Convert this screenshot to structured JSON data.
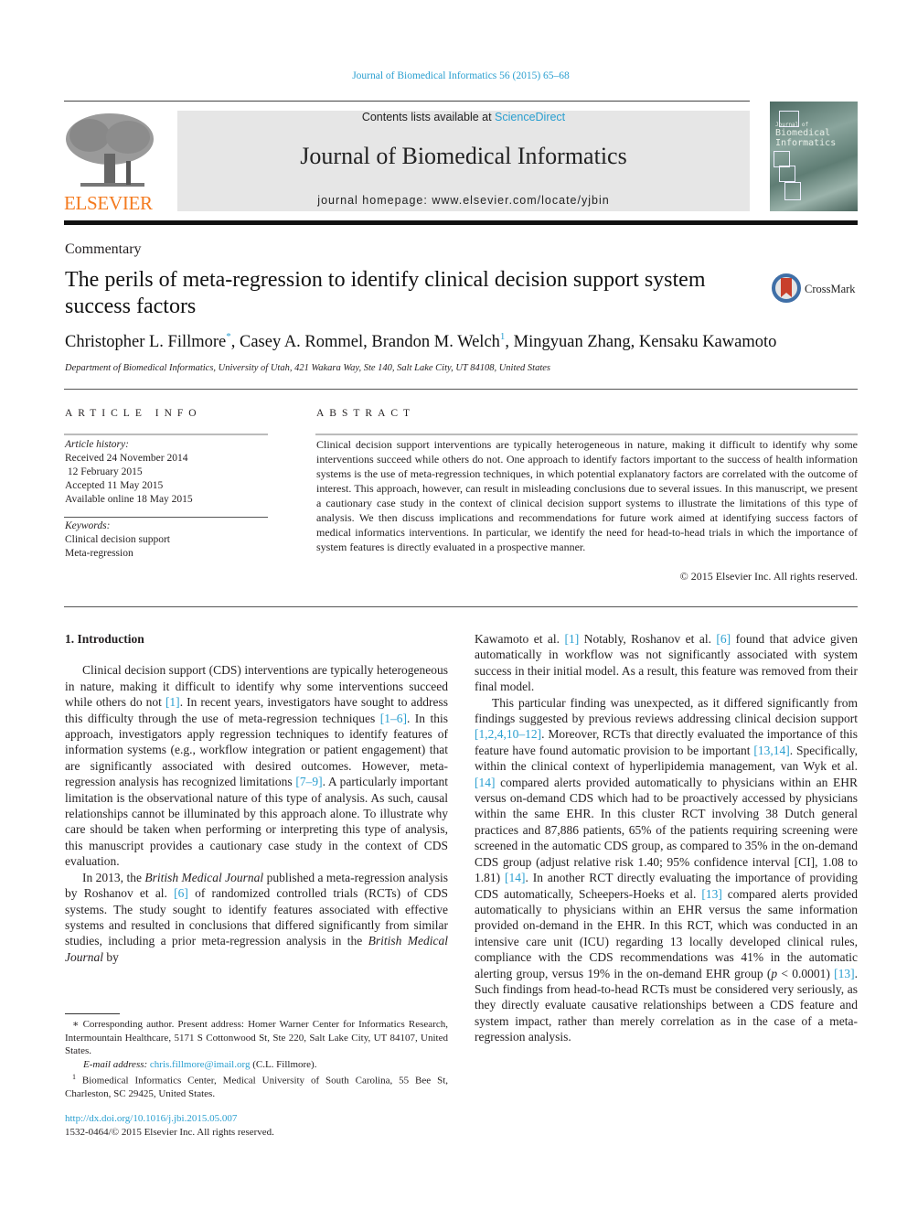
{
  "header": {
    "journal_reference": "Journal of Biomedical Informatics 56 (2015) 65–68",
    "contents_prefix": "Contents lists available at ",
    "contents_link": "ScienceDirect",
    "journal_title": "Journal of Biomedical Informatics",
    "homepage_prefix": "journal homepage: ",
    "homepage_url": "www.elsevier.com/locate/yjbin",
    "publisher_logo_text": "ELSEVIER",
    "cover_text_line1": "Biomedical",
    "cover_text_line2": "Informatics",
    "cover_small": "Journal of"
  },
  "article": {
    "type": "Commentary",
    "title": "The perils of meta-regression to identify clinical decision support system success factors",
    "crossmark_label": "CrossMark",
    "authors": [
      {
        "name": "Christopher L. Fillmore",
        "mark": "*"
      },
      {
        "name": "Casey A. Rommel",
        "mark": ""
      },
      {
        "name": "Brandon M. Welch",
        "mark": "1"
      },
      {
        "name": "Mingyuan Zhang",
        "mark": ""
      },
      {
        "name": "Kensaku Kawamoto",
        "mark": ""
      }
    ],
    "affiliation": "Department of Biomedical Informatics, University of Utah, 421 Wakara Way, Ste 140, Salt Lake City, UT 84108, United States"
  },
  "article_info": {
    "heading": "ARTICLE INFO",
    "history_label": "Article history:",
    "history": [
      "Received 24 November 2014",
      " 12 February 2015",
      "Accepted 11 May 2015",
      "Available online 18 May 2015"
    ],
    "keywords_label": "Keywords:",
    "keywords": [
      "Clinical decision support",
      "Meta-regression"
    ]
  },
  "abstract": {
    "heading": "ABSTRACT",
    "text": "Clinical decision support interventions are typically heterogeneous in nature, making it difficult to identify why some interventions succeed while others do not. One approach to identify factors important to the success of health information systems is the use of meta-regression techniques, in which potential explanatory factors are correlated with the outcome of interest. This approach, however, can result in misleading conclusions due to several issues. In this manuscript, we present a cautionary case study in the context of clinical decision support systems to illustrate the limitations of this type of analysis. We then discuss implications and recommendations for future work aimed at identifying success factors of medical informatics interventions. In particular, we identify the need for head-to-head trials in which the importance of system features is directly evaluated in a prospective manner.",
    "copyright": "© 2015 Elsevier Inc. All rights reserved."
  },
  "body": {
    "section_heading": "1. Introduction",
    "left_paragraphs": [
      [
        {
          "t": "Clinical decision support (CDS) interventions are typically heterogeneous in nature, making it difficult to identify why some interventions succeed while others do not "
        },
        {
          "ref": "[1]"
        },
        {
          "t": ". In recent years, investigators have sought to address this difficulty through the use of meta-regression techniques "
        },
        {
          "ref": "[1–6]"
        },
        {
          "t": ". In this approach, investigators apply regression techniques to identify features of information systems (e.g., workflow integration or patient engagement) that are significantly associated with desired outcomes. However, meta-regression analysis has recognized limitations "
        },
        {
          "ref": "[7–9]"
        },
        {
          "t": ". A particularly important limitation is the observational nature of this type of analysis. As such, causal relationships cannot be illuminated by this approach alone. To illustrate why care should be taken when performing or interpreting this type of analysis, this manuscript provides a cautionary case study in the context of CDS evaluation."
        }
      ],
      [
        {
          "t": "In 2013, the "
        },
        {
          "i": "British Medical Journal"
        },
        {
          "t": " published a meta-regression analysis by Roshanov et al. "
        },
        {
          "ref": "[6]"
        },
        {
          "t": " of randomized controlled trials (RCTs) of CDS systems. The study sought to identify features associated with effective systems and resulted in conclusions that differed significantly from similar studies, including a prior meta-regression analysis in the "
        },
        {
          "i": "British Medical Journal"
        },
        {
          "t": " by"
        }
      ]
    ],
    "right_paragraphs": [
      [
        {
          "t": "Kawamoto et al. "
        },
        {
          "ref": "[1]"
        },
        {
          "t": " Notably, Roshanov et al. "
        },
        {
          "ref": "[6]"
        },
        {
          "t": " found that advice given automatically in workflow was not significantly associated with system success in their initial model. As a result, this feature was removed from their final model."
        }
      ],
      [
        {
          "t": "This particular finding was unexpected, as it differed significantly from findings suggested by previous reviews addressing clinical decision support "
        },
        {
          "ref": "[1,2,4,10–12]"
        },
        {
          "t": ". Moreover, RCTs that directly evaluated the importance of this feature have found automatic provision to be important "
        },
        {
          "ref": "[13,14]"
        },
        {
          "t": ". Specifically, within the clinical context of hyperlipidemia management, van Wyk et al. "
        },
        {
          "ref": "[14]"
        },
        {
          "t": " compared alerts provided automatically to physicians within an EHR versus on-demand CDS which had to be proactively accessed by physicians within the same EHR. In this cluster RCT involving 38 Dutch general practices and 87,886 patients, 65% of the patients requiring screening were screened in the automatic CDS group, as compared to 35% in the on-demand CDS group (adjust relative risk 1.40; 95% confidence interval [CI], 1.08 to 1.81) "
        },
        {
          "ref": "[14]"
        },
        {
          "t": ". In another RCT directly evaluating the importance of providing CDS automatically, Scheepers-Hoeks et al. "
        },
        {
          "ref": "[13]"
        },
        {
          "t": " compared alerts provided automatically to physicians within an EHR versus the same information provided on-demand in the EHR. In this RCT, which was conducted in an intensive care unit (ICU) regarding 13 locally developed clinical rules, compliance with the CDS recommendations was 41% in the automatic alerting group, versus 19% in the on-demand EHR group ("
        },
        {
          "i": "p"
        },
        {
          "t": " < 0.0001) "
        },
        {
          "ref": "[13]"
        },
        {
          "t": ". Such findings from head-to-head RCTs must be considered very seriously, as they directly evaluate causative relationships between a CDS feature and system impact, rather than merely correlation as in the case of a meta-regression analysis."
        }
      ]
    ]
  },
  "footnotes": {
    "corresponding": "∗ Corresponding author. Present address: Homer Warner Center for Informatics Research, Intermountain Healthcare, 5171 S Cottonwood St, Ste 220, Salt Lake City, UT 84107, United States.",
    "email_label": "E-mail address:",
    "email": "chris.fillmore@imail.org",
    "email_suffix": " (C.L. Fillmore).",
    "note1_mark": "1",
    "note1": " Biomedical Informatics Center, Medical University of South Carolina, 55 Bee St, Charleston, SC 29425, United States.",
    "doi": "http://dx.doi.org/10.1016/j.jbi.2015.05.007",
    "issn_copyright": "1532-0464/© 2015 Elsevier Inc. All rights reserved."
  },
  "colors": {
    "link": "#2a9fd0",
    "elsevier_orange": "#f47b20",
    "masthead_bg": "#e6e6e6",
    "crossmark_red": "#c8402c",
    "crossmark_ring": "#3f6fa7"
  }
}
